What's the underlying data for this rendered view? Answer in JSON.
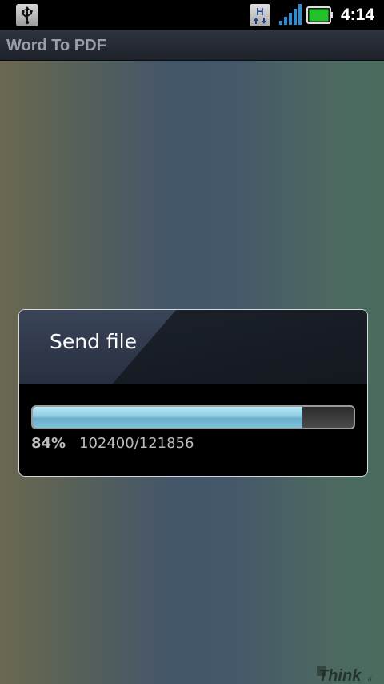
{
  "status_bar": {
    "time": "4:14",
    "icons": [
      "usb-icon",
      "hspa-data-icon",
      "signal-strength-icon",
      "battery-icon"
    ]
  },
  "app": {
    "title": "Word To PDF"
  },
  "dialog": {
    "title": "Send file",
    "progress_fraction": 0.84,
    "percent_text": "84%",
    "bytes_text": "102400/121856"
  },
  "colors": {
    "progress_fill": "#8fcbe2",
    "battery": "#22c22a",
    "signal": "#2a8fd6"
  }
}
